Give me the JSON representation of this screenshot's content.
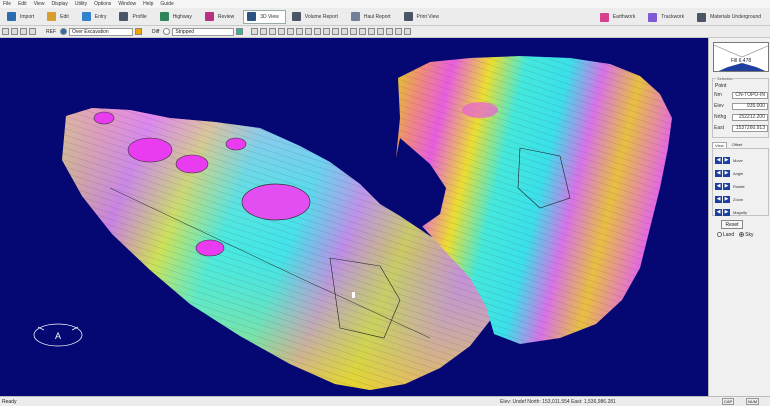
{
  "menu": [
    "File",
    "Edit",
    "View",
    "Display",
    "Utility",
    "Options",
    "Window",
    "Help",
    "Guide"
  ],
  "toolbar": {
    "buttons": [
      {
        "label": "Import",
        "color": "#2b6cb0"
      },
      {
        "label": "Edit",
        "color": "#d69e2e"
      },
      {
        "label": "Entry",
        "color": "#3182ce"
      },
      {
        "label": "Profile",
        "color": "#4a5568"
      },
      {
        "label": "Highway",
        "color": "#2f855a"
      },
      {
        "label": "Review",
        "color": "#b83280"
      },
      {
        "label": "3D View",
        "color": "#2c5282"
      },
      {
        "label": "Volume Report",
        "color": "#4a5568"
      },
      {
        "label": "Haul Report",
        "color": "#718096"
      },
      {
        "label": "Print View",
        "color": "#4a5568"
      }
    ],
    "right_buttons": [
      {
        "label": "Earthwork",
        "color": "#d53f8c"
      },
      {
        "label": "Trackwork",
        "color": "#805ad5"
      },
      {
        "label": "Materials Underground",
        "color": "#4a5568"
      }
    ]
  },
  "toolbar2": {
    "ref_label": "REF",
    "ref_value": "Over Excavation",
    "diff_label": "Diff",
    "diff_value": "Stripped"
  },
  "side": {
    "fill_value": "Fill 6.478",
    "selection_title": "Selection",
    "point_label": "Point",
    "rows": [
      {
        "k": "Nm",
        "v": "CN-TOPO-IN"
      },
      {
        "k": "Elev",
        "v": "935.000"
      },
      {
        "k": "Nrthg",
        "v": "152212.200"
      },
      {
        "k": "East",
        "v": "1537260.913"
      }
    ],
    "tabs": [
      "View",
      "Offset"
    ],
    "nav": [
      "Move",
      "Angle",
      "Rotate",
      "Zoom",
      "Magnify"
    ],
    "reset": "Reset",
    "radio_land": "Land",
    "radio_sky": "Sky"
  },
  "status": {
    "left": "Ready",
    "mid": "Elev: Undef     North: 153,011.554    East: 1,536,986.281",
    "indicators": [
      "CAP",
      "NUM"
    ]
  },
  "compass_letter": "A"
}
